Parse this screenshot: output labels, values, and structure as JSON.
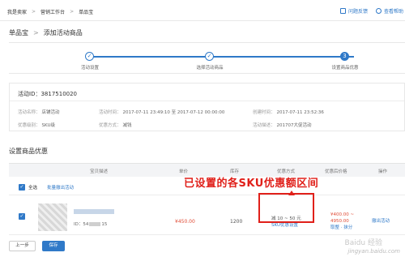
{
  "breadcrumb": [
    "我是卖家",
    "营销工作台",
    "单品宝"
  ],
  "top_links": [
    "问题反馈",
    "查看帮助"
  ],
  "page_title": [
    "单品宝",
    "添加活动商品"
  ],
  "steps": [
    {
      "label": "活动设置",
      "state": "done",
      "mark": "✓"
    },
    {
      "label": "选择活动商品",
      "state": "done",
      "mark": "✓"
    },
    {
      "label": "设置商品优惠",
      "state": "current",
      "mark": "3"
    }
  ],
  "activity": {
    "id_label": "活动ID：",
    "id_value": "3817510020",
    "name_label": "活动名称：",
    "name_value": "店铺活动",
    "time_label": "活动时间：",
    "time_value": "2017-07-11 23:49:10 至 2017-07-12 00:00:00",
    "created_label": "创建时间：",
    "created_value": "2017-07-11 23:52:36",
    "level_label": "优惠级别：",
    "level_value": "SKU级",
    "method_label": "优惠方式：",
    "method_value": "减钱",
    "desc_label": "活动描述：",
    "desc_value": "201707大促活动"
  },
  "section_title": "设置商品优惠",
  "table": {
    "headers": [
      "宝贝描述",
      "单价",
      "库存",
      "优惠方式",
      "优惠后价格",
      "操作"
    ],
    "select_all": "全选",
    "batch_remove": "批量撤出活动",
    "row": {
      "id_prefix": "ID：54",
      "id_suffix": "15",
      "price": "¥450.00",
      "stock": "1200",
      "discount_line": "减 10 ~ 50 元",
      "discount_link": "SKU优惠设置",
      "final_price_line1": "¥400.00 ~",
      "final_price_line2": "4950.00",
      "final_link": "取整 · 抹分",
      "operation": "撤出活动"
    }
  },
  "annotation": "已设置的各SKU优惠额区间",
  "buttons": {
    "prev": "上一步",
    "save": "保存"
  },
  "watermark": [
    "Baidu 经验",
    "jingyan.baidu.com"
  ],
  "colors": {
    "accent": "#2f79c8",
    "price": "#e04b35",
    "annotation": "#e0201a"
  }
}
